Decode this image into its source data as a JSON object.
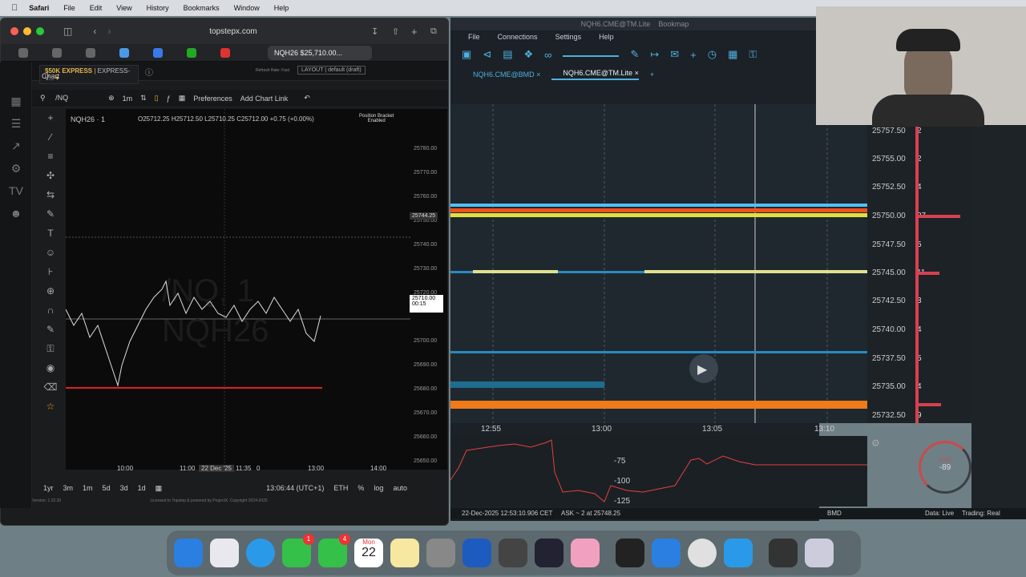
{
  "menubar": {
    "app": "Safari",
    "items": [
      "File",
      "Edit",
      "View",
      "History",
      "Bookmarks",
      "Window",
      "Help"
    ]
  },
  "safari": {
    "url": "topstepx.com",
    "active_tab": "NQH26 $25,710.00..."
  },
  "topstep": {
    "logo": "TOPSTEP X",
    "account": "$50K EXPRESS",
    "account_sub": "EXPRESS-V...",
    "refresh": "Refresh Rate: Fast",
    "layout": "LAYOUT | default (draft)",
    "chart_label": "Chart",
    "toolbar": {
      "symbol": "/NQ",
      "interval": "1m",
      "preferences": "Preferences",
      "add_link": "Add Chart Link"
    },
    "symbol_row": "NQH26 · 1",
    "ohlc": "O25712.25 H25712.50 L25710.25 C25712.00 +0.75 (+0.00%)",
    "position_bracket": "Position Bracket",
    "position_bracket_sub": "Enabled",
    "price_scale": [
      "25780.00",
      "25770.00",
      "25760.00",
      "25750.00",
      "25740.00",
      "25730.00",
      "25720.00",
      "25710.00",
      "25700.00",
      "25690.00",
      "25680.00",
      "25670.00",
      "25660.00",
      "25650.00"
    ],
    "crosshair_price": "25744.25",
    "current_price": "25710.00",
    "countdown": "00:15",
    "time_axis": [
      "10:00",
      "11:00",
      "22 Dec '25",
      "11:35",
      "0",
      "13:00",
      "14:00"
    ],
    "watermark_1": "/NQ, 1",
    "watermark_2": "NQH26",
    "bottom": {
      "ranges": [
        "1yr",
        "3m",
        "1m",
        "5d",
        "3d",
        "1d"
      ],
      "clock": "13:06:44 (UTC+1)",
      "session": "ETH",
      "pct": "%",
      "log": "log",
      "auto": "auto"
    },
    "footer": "Licensed to Topstep & powered by ProjectX. Copyright 2024-2025",
    "version": "Version: 1.22.30"
  },
  "bookmap": {
    "title": "NQH6.CME@TM.Lite",
    "app": "Bookmap",
    "menu": [
      "File",
      "Connections",
      "Settings",
      "Help"
    ],
    "tabs": [
      "NQH6.CME@BMD",
      "NQH6.CME@TM.Lite"
    ],
    "ladder": [
      {
        "price": "25757.50",
        "size": "2"
      },
      {
        "price": "25755.00",
        "size": "2"
      },
      {
        "price": "25752.50",
        "size": "4"
      },
      {
        "price": "25750.00",
        "size": "27"
      },
      {
        "price": "25747.50",
        "size": "5"
      },
      {
        "price": "25745.00",
        "size": "11"
      },
      {
        "price": "25742.50",
        "size": "3"
      },
      {
        "price": "25740.00",
        "size": "4"
      },
      {
        "price": "25737.50",
        "size": "5"
      },
      {
        "price": "25735.00",
        "size": "4"
      },
      {
        "price": "25732.50",
        "size": "9"
      }
    ],
    "times": [
      "12:55",
      "13:00",
      "13:05",
      "13:10"
    ],
    "cvd_labels": [
      "-75",
      "-100",
      "-125"
    ],
    "cvd_title": "CVD",
    "cvd_value": "-89",
    "status": {
      "time": "22-Dec-2025 12:53:10.906 CET",
      "ask": "ASK ~ 2 at 25748.25",
      "feed": "BMD",
      "data": "Data: Live",
      "trading": "Trading: Real"
    }
  },
  "dock": {
    "calendar_month": "Mon",
    "calendar_day": "22",
    "badge_messages": "1",
    "badge_facetime": "4"
  }
}
